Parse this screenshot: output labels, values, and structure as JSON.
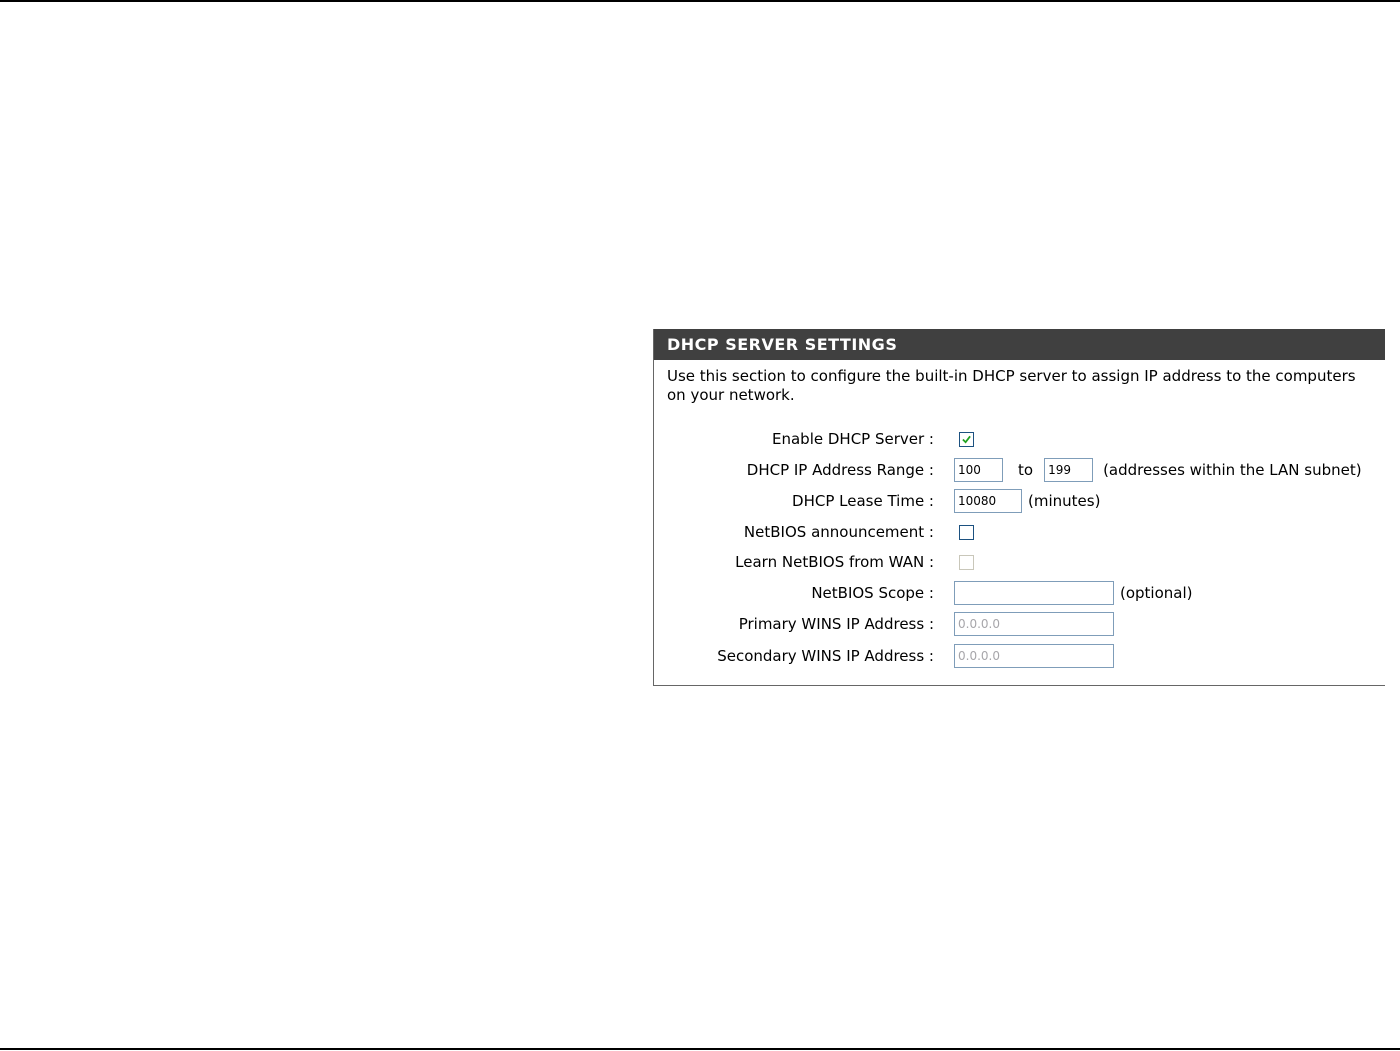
{
  "panel": {
    "title": "DHCP SERVER SETTINGS",
    "description": "Use this section to configure the built-in DHCP server to assign IP address to the computers on your network."
  },
  "fields": {
    "enable_dhcp": {
      "label": "Enable DHCP Server :",
      "checked": true
    },
    "ip_range": {
      "label": "DHCP IP Address Range :",
      "start": "100",
      "to_text": "to",
      "end": "199",
      "note": "(addresses within the LAN subnet)"
    },
    "lease_time": {
      "label": "DHCP Lease Time :",
      "value": "10080",
      "unit": "(minutes)"
    },
    "netbios_announce": {
      "label": "NetBIOS announcement :",
      "checked": false
    },
    "netbios_wan": {
      "label": "Learn NetBIOS from WAN :",
      "checked": false,
      "disabled": true
    },
    "netbios_scope": {
      "label": "NetBIOS Scope :",
      "value": "",
      "note": "(optional)"
    },
    "primary_wins": {
      "label": "Primary WINS IP Address :",
      "value": "0.0.0.0",
      "disabled": true
    },
    "secondary_wins": {
      "label": "Secondary WINS IP Address :",
      "value": "0.0.0.0",
      "disabled": true
    }
  },
  "colors": {
    "header_bg": "#404040",
    "header_text": "#ffffff",
    "checkbox_border": "#1c5180",
    "checkmark": "#21a121",
    "input_border": "#7f9db9"
  }
}
